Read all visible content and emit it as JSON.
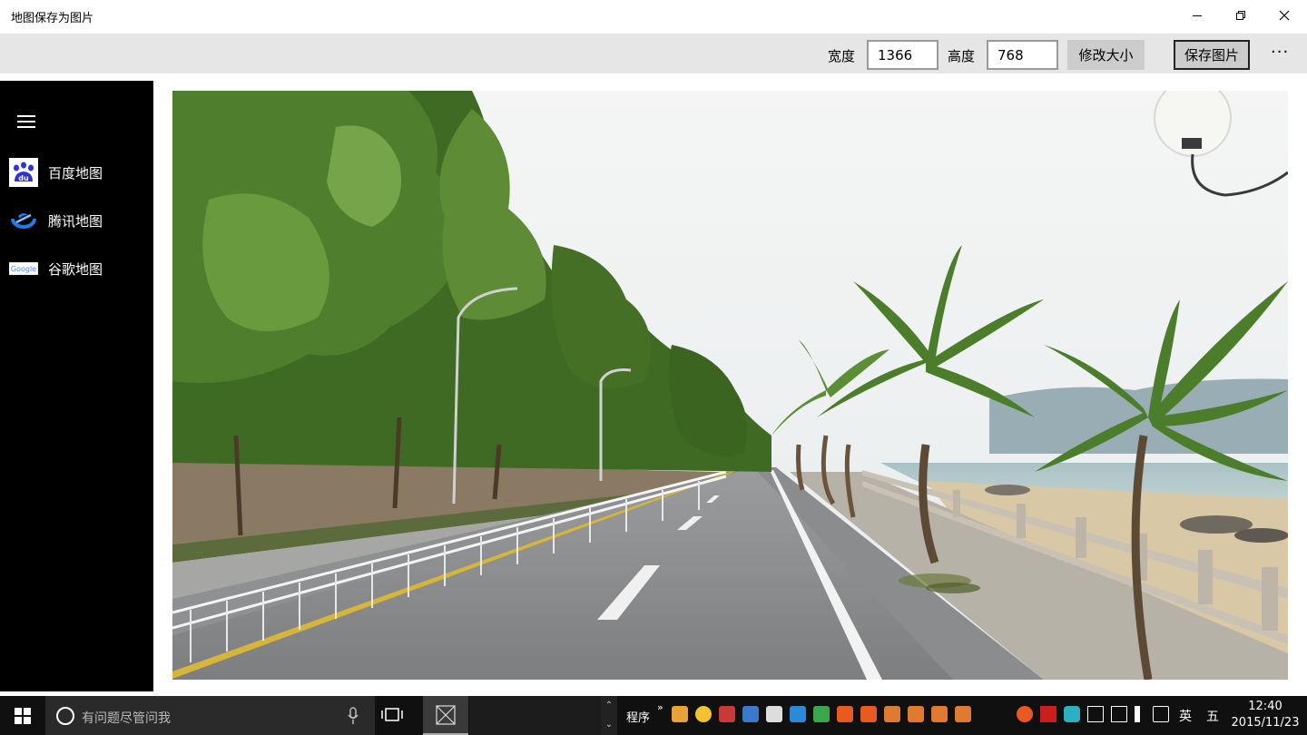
{
  "window": {
    "title": "地图保存为图片"
  },
  "toolbar": {
    "width_label": "宽度",
    "width_value": "1366",
    "height_label": "高度",
    "height_value": "768",
    "resize_button": "修改大小",
    "save_button": "保存图片",
    "more": "···"
  },
  "sidebar": {
    "items": [
      {
        "label": "百度地图",
        "icon": "baidu-icon"
      },
      {
        "label": "腾讯地图",
        "icon": "tencent-icon"
      },
      {
        "label": "谷歌地图",
        "icon": "google-icon"
      }
    ],
    "baidu_icon_text": "du",
    "google_icon_text": "Google"
  },
  "taskbar": {
    "search_placeholder": "有问题尽管问我",
    "quick_launch_label": "程序",
    "quick_launch_more": "»",
    "ime_lang": "英",
    "ime_mode": "五",
    "time": "12:40",
    "date": "2015/11/23"
  },
  "colors": {
    "toolbar_bg": "#e6e6e6",
    "sidebar_bg": "#000000",
    "baidu_blue": "#2932e1",
    "tencent_blue": "#1e7ce8",
    "taskbar_bg": "#101010"
  }
}
